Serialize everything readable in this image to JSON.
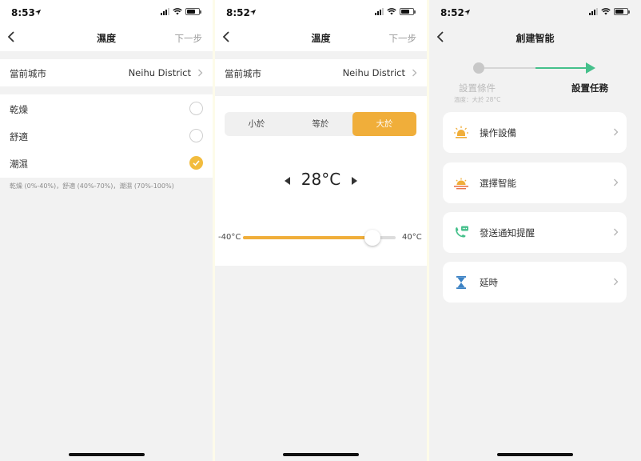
{
  "screens": [
    {
      "status": {
        "time": "8:53"
      },
      "nav": {
        "title": "濕度",
        "next": "下一步"
      },
      "city": {
        "label": "當前城市",
        "value": "Neihu District"
      },
      "options": [
        {
          "label": "乾燥",
          "checked": false
        },
        {
          "label": "舒適",
          "checked": false
        },
        {
          "label": "潮濕",
          "checked": true
        }
      ],
      "hint": "乾燥 (0%-40%)，舒適 (40%-70%)，潮濕 (70%-100%)"
    },
    {
      "status": {
        "time": "8:52"
      },
      "nav": {
        "title": "溫度",
        "next": "下一步"
      },
      "city": {
        "label": "當前城市",
        "value": "Neihu District"
      },
      "comparator": {
        "options": [
          "小於",
          "等於",
          "大於"
        ],
        "selected": "大於"
      },
      "temperature": {
        "value": "28°C",
        "min": "-40°C",
        "max": "40°C",
        "slider_fraction": 0.85
      }
    },
    {
      "status": {
        "time": "8:52"
      },
      "nav": {
        "title": "創建智能"
      },
      "steps": {
        "step1": "設置條件",
        "step1_sub": "溫度：大於 28°C",
        "step2": "設置任務"
      },
      "tasks": [
        {
          "label": "操作設備",
          "icon": "bulb-icon"
        },
        {
          "label": "選擇智能",
          "icon": "sunset-icon"
        },
        {
          "label": "發送通知提醒",
          "icon": "phone-sms-icon"
        },
        {
          "label": "延時",
          "icon": "hourglass-icon"
        }
      ]
    }
  ],
  "colors": {
    "accent": "#f0ae3a",
    "check": "#f2bc3e",
    "green": "#45c08b",
    "blue": "#3b82c4"
  }
}
